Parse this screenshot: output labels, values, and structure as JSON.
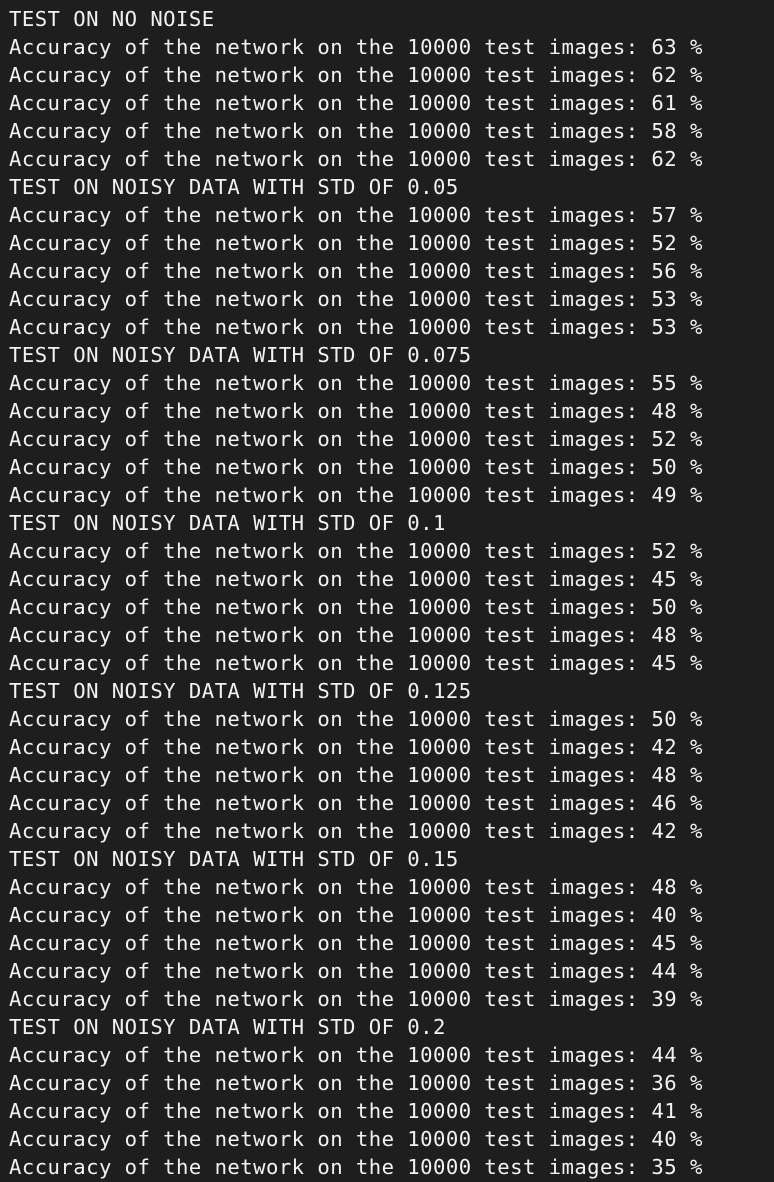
{
  "terminal": {
    "lines": [
      "TEST ON NO NOISE",
      "Accuracy of the network on the 10000 test images: 63 %",
      "Accuracy of the network on the 10000 test images: 62 %",
      "Accuracy of the network on the 10000 test images: 61 %",
      "Accuracy of the network on the 10000 test images: 58 %",
      "Accuracy of the network on the 10000 test images: 62 %",
      "TEST ON NOISY DATA WITH STD OF 0.05",
      "Accuracy of the network on the 10000 test images: 57 %",
      "Accuracy of the network on the 10000 test images: 52 %",
      "Accuracy of the network on the 10000 test images: 56 %",
      "Accuracy of the network on the 10000 test images: 53 %",
      "Accuracy of the network on the 10000 test images: 53 %",
      "TEST ON NOISY DATA WITH STD OF 0.075",
      "Accuracy of the network on the 10000 test images: 55 %",
      "Accuracy of the network on the 10000 test images: 48 %",
      "Accuracy of the network on the 10000 test images: 52 %",
      "Accuracy of the network on the 10000 test images: 50 %",
      "Accuracy of the network on the 10000 test images: 49 %",
      "TEST ON NOISY DATA WITH STD OF 0.1",
      "Accuracy of the network on the 10000 test images: 52 %",
      "Accuracy of the network on the 10000 test images: 45 %",
      "Accuracy of the network on the 10000 test images: 50 %",
      "Accuracy of the network on the 10000 test images: 48 %",
      "Accuracy of the network on the 10000 test images: 45 %",
      "TEST ON NOISY DATA WITH STD OF 0.125",
      "Accuracy of the network on the 10000 test images: 50 %",
      "Accuracy of the network on the 10000 test images: 42 %",
      "Accuracy of the network on the 10000 test images: 48 %",
      "Accuracy of the network on the 10000 test images: 46 %",
      "Accuracy of the network on the 10000 test images: 42 %",
      "TEST ON NOISY DATA WITH STD OF 0.15",
      "Accuracy of the network on the 10000 test images: 48 %",
      "Accuracy of the network on the 10000 test images: 40 %",
      "Accuracy of the network on the 10000 test images: 45 %",
      "Accuracy of the network on the 10000 test images: 44 %",
      "Accuracy of the network on the 10000 test images: 39 %",
      "TEST ON NOISY DATA WITH STD OF 0.2",
      "Accuracy of the network on the 10000 test images: 44 %",
      "Accuracy of the network on the 10000 test images: 36 %",
      "Accuracy of the network on the 10000 test images: 41 %",
      "Accuracy of the network on the 10000 test images: 40 %",
      "Accuracy of the network on the 10000 test images: 35 %"
    ]
  }
}
